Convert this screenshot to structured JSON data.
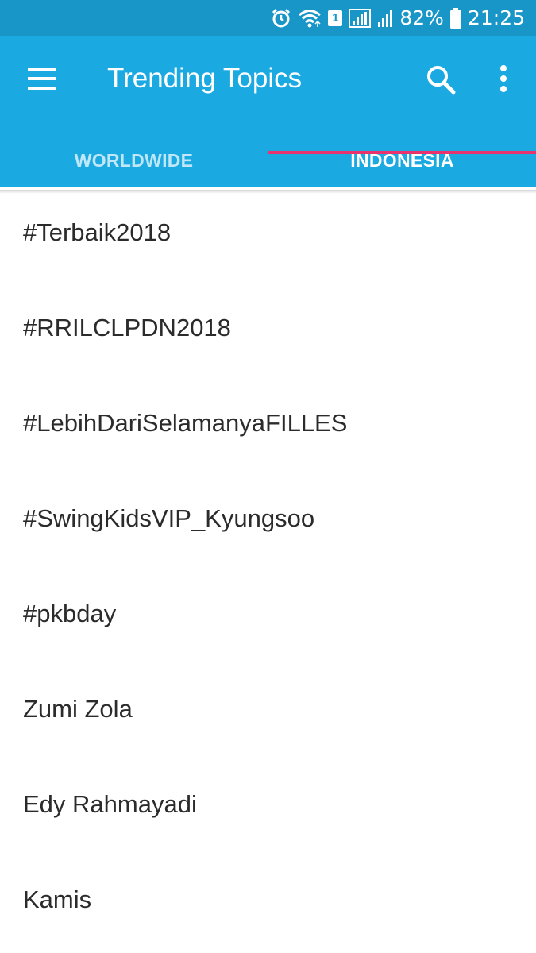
{
  "status_bar": {
    "battery": "82%",
    "time": "21:25",
    "sim_slot": "1",
    "icons": [
      "alarm-icon",
      "wifi-icon",
      "sim-icon",
      "signal-icon",
      "signal-icon",
      "battery-icon"
    ]
  },
  "app_bar": {
    "title": "Trending Topics",
    "icons": [
      "menu-icon",
      "search-icon",
      "more-vert-icon"
    ],
    "color": "#1ba9e1"
  },
  "tabs": [
    {
      "label": "WORLDWIDE",
      "selected": false
    },
    {
      "label": "INDONESIA",
      "selected": true
    }
  ],
  "accent_color": "#e8336f",
  "trends": [
    "#Terbaik2018",
    "#RRILCLPDN2018",
    "#LebihDariSelamanyaFILLES",
    "#SwingKidsVIP_Kyungsoo",
    "#pkbday",
    "Zumi Zola",
    "Edy Rahmayadi",
    "Kamis"
  ]
}
